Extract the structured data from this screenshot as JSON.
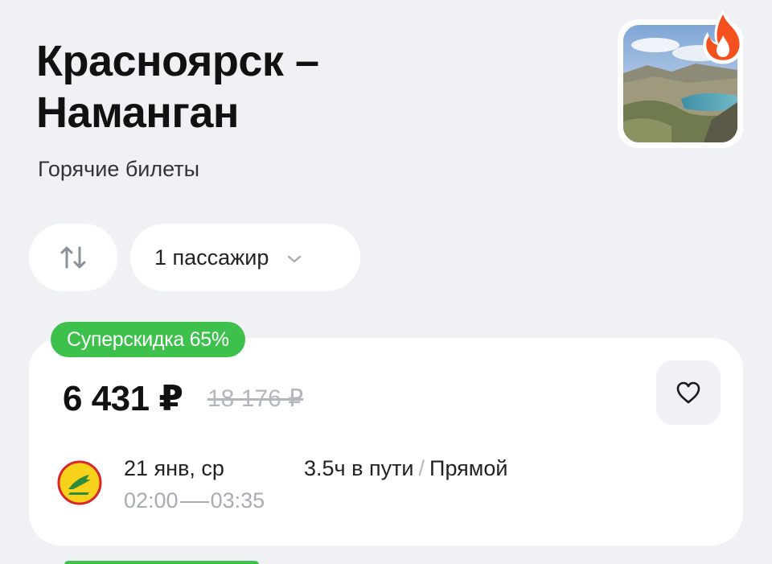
{
  "header": {
    "title_line1": "Красноярск –",
    "title_line2": "Наманган",
    "subtitle": "Горячие билеты"
  },
  "hero": {
    "image_icon": "landscape-photo",
    "badge_icon": "fire-icon"
  },
  "controls": {
    "swap_icon": "swap-vertical-icon",
    "passengers_label": "1 пассажир",
    "passengers_chevron_icon": "chevron-down-icon"
  },
  "offer": {
    "badge": "Суперскидка 65%",
    "price": "6 431 ₽",
    "old_price": "18 176 ₽",
    "favorite_icon": "heart-icon",
    "airline_logo_icon": "airline-logo",
    "date": "21 янв, ср",
    "departure": "02:00",
    "arrival": "03:35",
    "duration": "3.5ч в пути",
    "separator": "/",
    "flight_type": "Прямой"
  },
  "colors": {
    "background": "#eff1f5",
    "card": "#ffffff",
    "badge_green": "#3ec04d",
    "fire_orange": "#f4511e",
    "muted_text": "#a7abb3"
  }
}
